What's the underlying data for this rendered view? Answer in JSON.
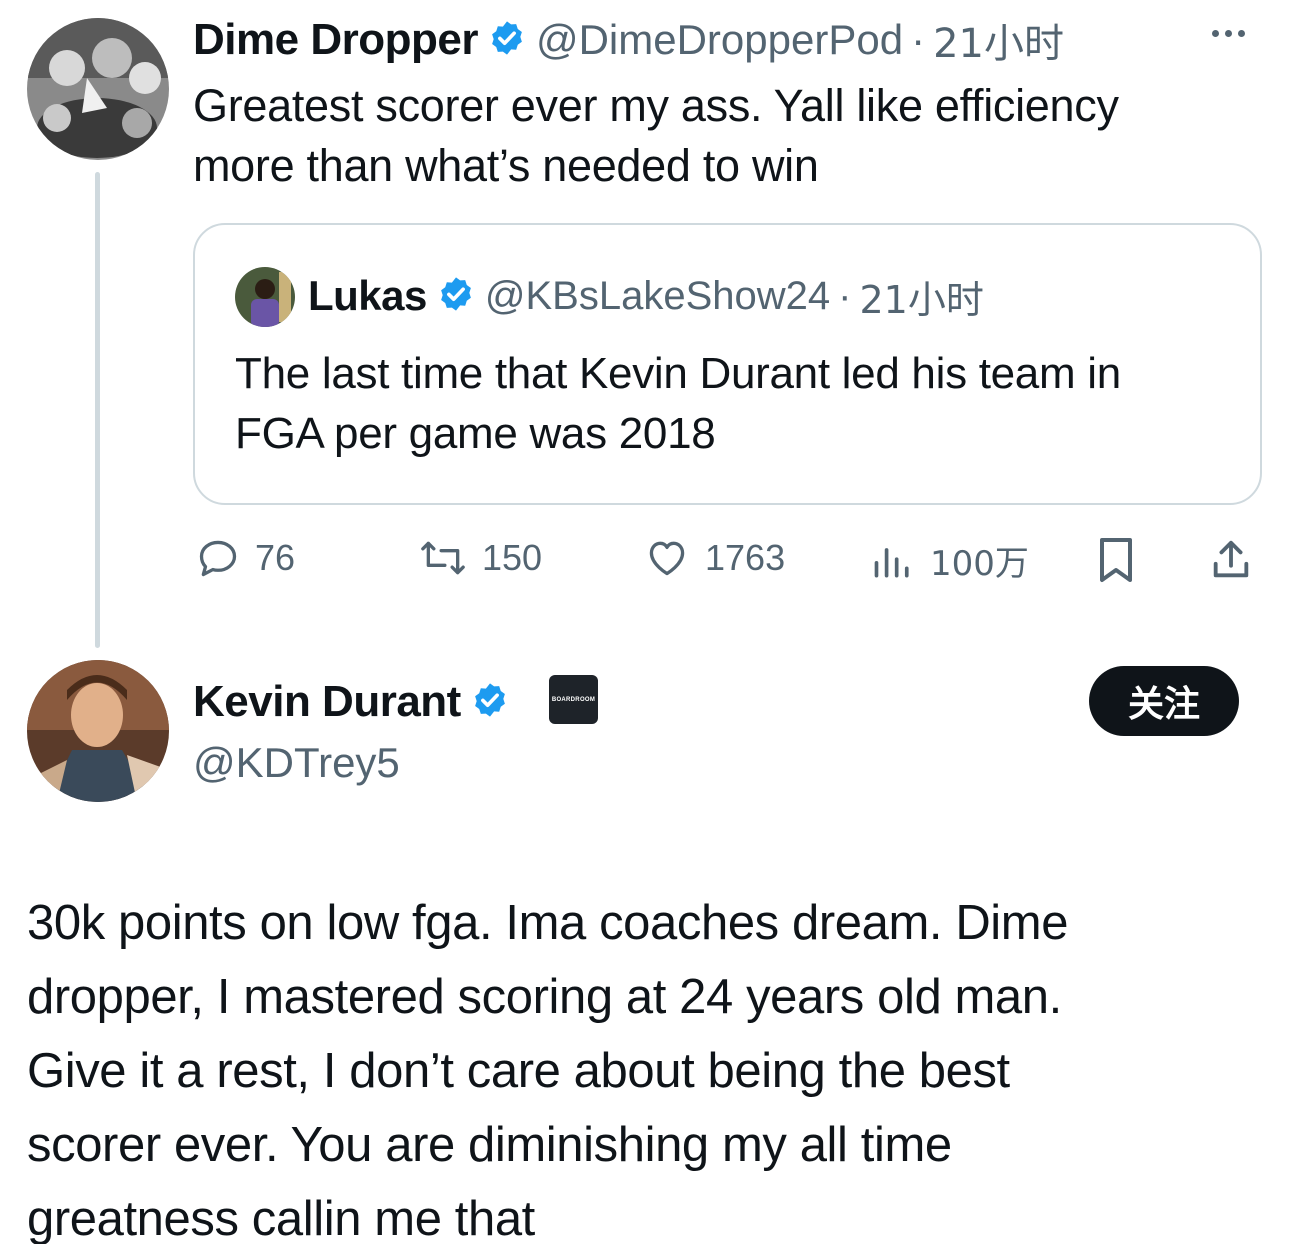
{
  "parent_tweet": {
    "author_name": "Dime Dropper",
    "handle": "@DimeDropperPod",
    "time": "21小时",
    "text_lines": [
      "Greatest scorer ever my ass. Yall like efficiency",
      "more than what’s needed to win"
    ],
    "quote": {
      "author_name": "Lukas",
      "handle": "@KBsLakeShow24",
      "time": "21小时",
      "text_lines": [
        "The last time that Kevin Durant led his team in",
        "FGA per game was 2018"
      ]
    },
    "stats": {
      "replies": "76",
      "retweets": "150",
      "likes": "1763",
      "views": "100万"
    }
  },
  "main_tweet": {
    "author_name": "Kevin Durant",
    "handle": "@KDTrey5",
    "affiliate_badge": "BOARDROOM",
    "follow_label": "关注",
    "text_lines": [
      "30k points on low fga. Ima coaches dream. Dime",
      "dropper, I mastered scoring at 24 years old man.",
      "Give it a rest, I don’t care about being the best",
      "scorer ever. You are diminishing my all time",
      "greatness callin me that"
    ]
  },
  "colors": {
    "text": "#0f1419",
    "secondary": "#536471",
    "verified": "#1d9bf0",
    "border": "#cfd9de"
  }
}
